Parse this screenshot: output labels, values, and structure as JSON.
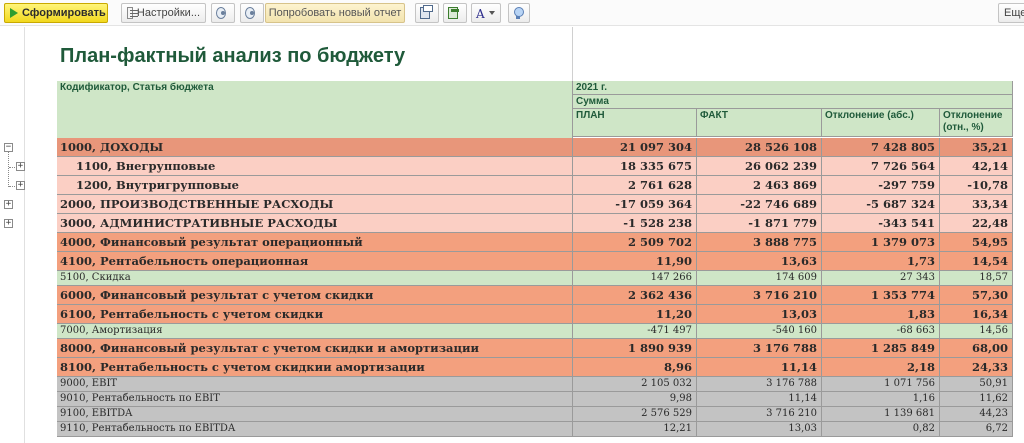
{
  "toolbar": {
    "generate_label": "Сформировать",
    "settings_label": "Настройки...",
    "try_report_label": "Попробовать новый отчет",
    "font_label": "A",
    "more_label": "Еще"
  },
  "report": {
    "title": "План-фактный анализ по бюджету",
    "header": {
      "codifier": "Кодификатор, Статья бюджета",
      "year": "2021 г.",
      "sum": "Сумма",
      "plan": "ПЛАН",
      "fact": "ФАКТ",
      "dev_abs": "Отклонение (абс.)",
      "dev_rel": "Отклонение (отн., %)"
    },
    "colors": {
      "income": "#e8967a",
      "income_sub": "#fbcfc4",
      "expense": "#fbcfc4",
      "result": "#f3a07e",
      "neutral": "#cfe6c7",
      "gray": "#c3c3c3",
      "header": "#cfe6c7"
    },
    "rows": [
      {
        "name": "1000, ДОХОДЫ",
        "plan": "21 097 304",
        "fact": "28 526 108",
        "abs": "7 428 805",
        "rel": "35,21",
        "style": "income",
        "toggle": "−"
      },
      {
        "name": "1100, Внегрупповые",
        "plan": "18 335 675",
        "fact": "26 062 239",
        "abs": "7 726 564",
        "rel": "42,14",
        "style": "income_sub",
        "toggle": "+"
      },
      {
        "name": "1200, Внутригрупповые",
        "plan": "2 761 628",
        "fact": "2 463 869",
        "abs": "-297 759",
        "rel": "-10,78",
        "style": "income_sub",
        "toggle": "+"
      },
      {
        "name": "2000, ПРОИЗВОДСТВЕННЫЕ РАСХОДЫ",
        "plan": "-17 059 364",
        "fact": "-22 746 689",
        "abs": "-5 687 324",
        "rel": "33,34",
        "style": "expense",
        "toggle": "+"
      },
      {
        "name": "3000, АДМИНИСТРАТИВНЫЕ РАСХОДЫ",
        "plan": "-1 528 238",
        "fact": "-1 871 779",
        "abs": "-343 541",
        "rel": "22,48",
        "style": "expense",
        "toggle": "+"
      },
      {
        "name": "4000, Финансовый результат операционный",
        "plan": "2 509 702",
        "fact": "3 888 775",
        "abs": "1 379 073",
        "rel": "54,95",
        "style": "result",
        "toggle": ""
      },
      {
        "name": "4100, Рентабельность операционная",
        "plan": "11,90",
        "fact": "13,63",
        "abs": "1,73",
        "rel": "14,54",
        "style": "result",
        "toggle": ""
      },
      {
        "name": "5100, Скидка",
        "plan": "147 266",
        "fact": "174 609",
        "abs": "27 343",
        "rel": "18,57",
        "style": "neutral",
        "toggle": ""
      },
      {
        "name": "6000, Финансовый результат с учетом скидки",
        "plan": "2 362 436",
        "fact": "3 716 210",
        "abs": "1 353 774",
        "rel": "57,30",
        "style": "result",
        "toggle": ""
      },
      {
        "name": "6100, Рентабельность с учетом скидки",
        "plan": "11,20",
        "fact": "13,03",
        "abs": "1,83",
        "rel": "16,34",
        "style": "result",
        "toggle": ""
      },
      {
        "name": "7000, Амортизация",
        "plan": "-471 497",
        "fact": "-540 160",
        "abs": "-68 663",
        "rel": "14,56",
        "style": "neutral",
        "toggle": ""
      },
      {
        "name": "8000, Финансовый результат с учетом скидки и амортизации",
        "plan": "1 890 939",
        "fact": "3 176 788",
        "abs": "1 285 849",
        "rel": "68,00",
        "style": "result",
        "toggle": ""
      },
      {
        "name": "8100, Рентабельность с учетом скидкии амортизации",
        "plan": "8,96",
        "fact": "11,14",
        "abs": "2,18",
        "rel": "24,33",
        "style": "result",
        "toggle": ""
      },
      {
        "name": "9000, EBIT",
        "plan": "2 105 032",
        "fact": "3 176 788",
        "abs": "1 071 756",
        "rel": "50,91",
        "style": "gray",
        "toggle": ""
      },
      {
        "name": "9010, Рентабельность по EBIT",
        "plan": "9,98",
        "fact": "11,14",
        "abs": "1,16",
        "rel": "11,62",
        "style": "gray",
        "toggle": ""
      },
      {
        "name": "9100, EBITDA",
        "plan": "2 576 529",
        "fact": "3 716 210",
        "abs": "1 139 681",
        "rel": "44,23",
        "style": "gray",
        "toggle": ""
      },
      {
        "name": "9110, Рентабельность по EBITDA",
        "plan": "12,21",
        "fact": "13,03",
        "abs": "0,82",
        "rel": "6,72",
        "style": "gray",
        "toggle": ""
      }
    ]
  }
}
